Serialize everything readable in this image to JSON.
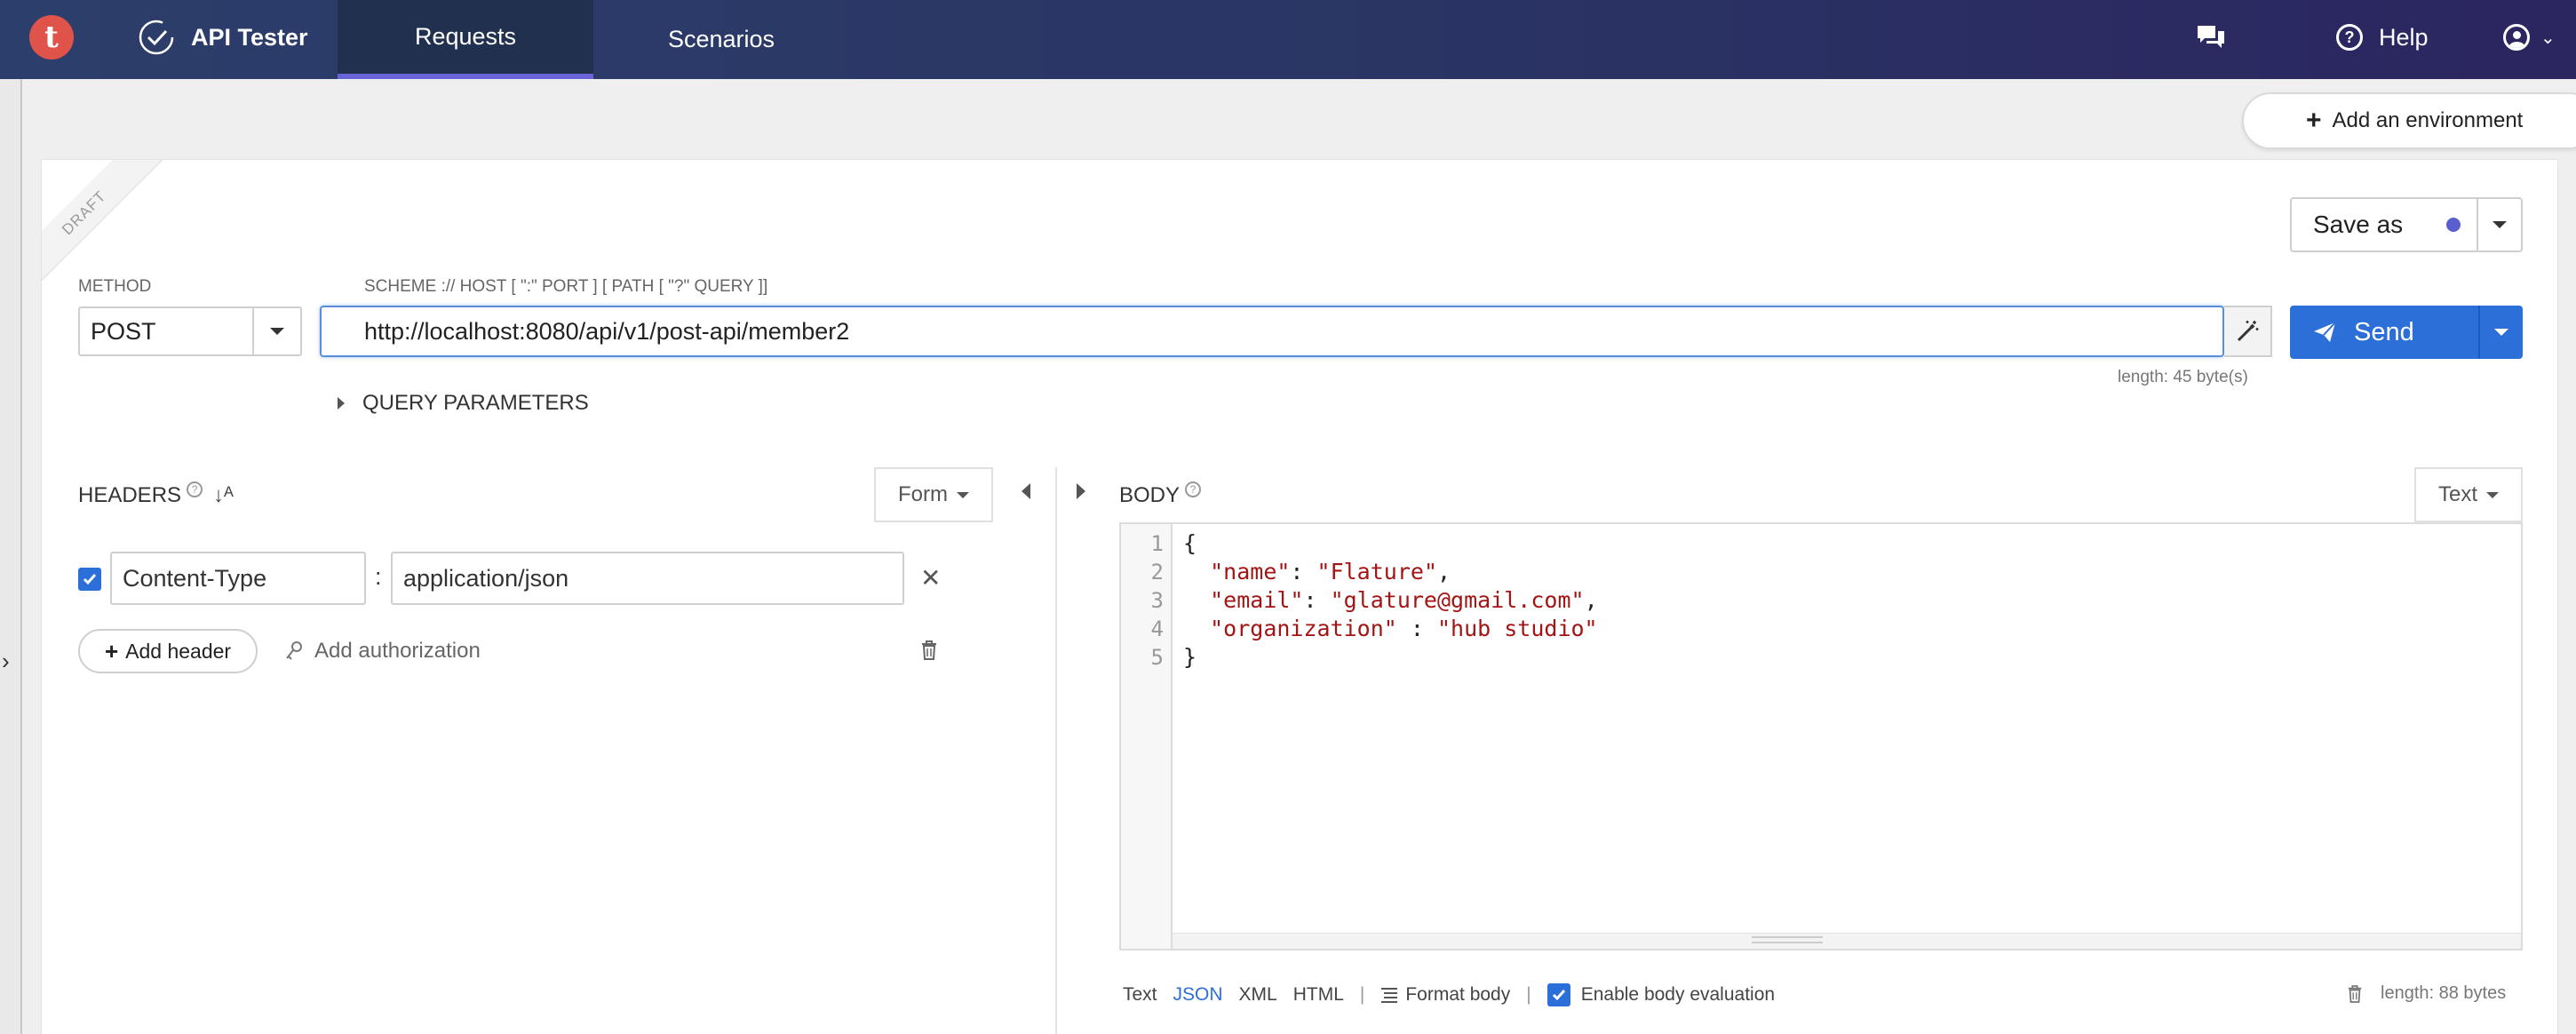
{
  "topbar": {
    "logo_letter": "t",
    "app_name": "API Tester",
    "tabs": [
      {
        "label": "Requests",
        "active": true
      },
      {
        "label": "Scenarios",
        "active": false
      }
    ],
    "help_label": "Help",
    "accent_color": "#6a63d8"
  },
  "environment": {
    "add_label": "Add an environment"
  },
  "request": {
    "draft_label": "DRAFT",
    "method_label": "METHOD",
    "method_value": "POST",
    "url_hint": "SCHEME :// HOST [ \":\" PORT ] [ PATH [ \"?\" QUERY ]]",
    "url_value": "http://localhost:8080/api/v1/post-api/member2",
    "url_length": "length: 45 byte(s)",
    "save_as_label": "Save as",
    "send_label": "Send",
    "send_color": "#2d6fd8",
    "query_params_label": "QUERY PARAMETERS"
  },
  "headers": {
    "title": "HEADERS",
    "mode_label": "Form",
    "items": [
      {
        "enabled": true,
        "key": "Content-Type",
        "value": "application/json"
      }
    ],
    "add_header_label": "Add header",
    "add_auth_label": "Add authorization"
  },
  "body": {
    "title": "BODY",
    "mode_label": "Text",
    "line_numbers": [
      "1",
      "2",
      "3",
      "4",
      "5"
    ],
    "code_lines": [
      {
        "key": "",
        "sep": "",
        "val": "",
        "raw": "{"
      },
      {
        "key": "\"name\"",
        "sep": ": ",
        "val": "\"Flature\"",
        "tail": ","
      },
      {
        "key": "\"email\"",
        "sep": ": ",
        "val": "\"glature@gmail.com\"",
        "tail": ","
      },
      {
        "key": "\"organization\"",
        "sep": " : ",
        "val": "\"hub studio\"",
        "tail": ""
      },
      {
        "key": "",
        "sep": "",
        "val": "",
        "raw": "}"
      }
    ],
    "formats": [
      "Text",
      "JSON",
      "XML",
      "HTML"
    ],
    "active_format": "JSON",
    "format_body_label": "Format body",
    "enable_eval_label": "Enable body evaluation",
    "length_label": "length: 88 bytes"
  }
}
